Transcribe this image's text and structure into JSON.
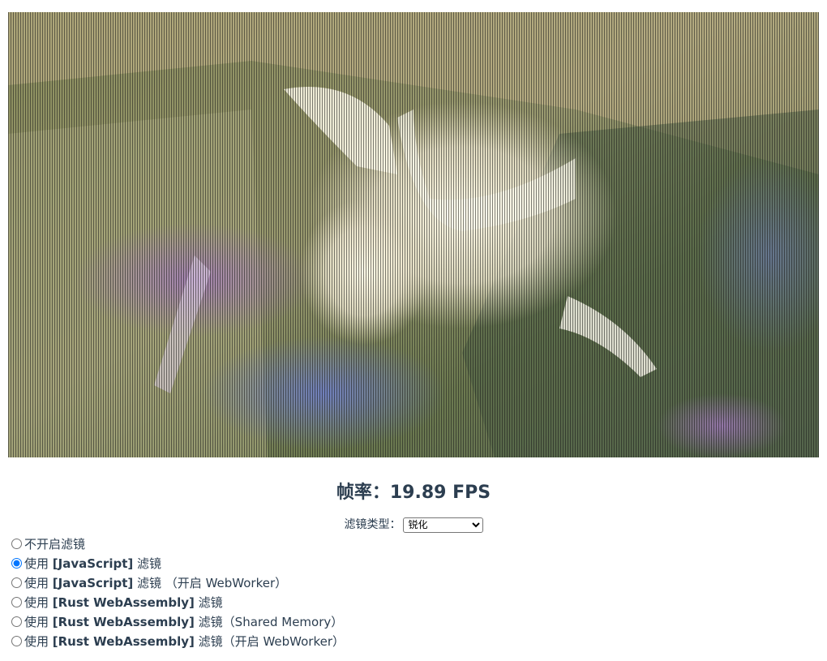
{
  "video": {
    "description_icon": "video-canvas"
  },
  "fps": {
    "label": "帧率：",
    "value": "19.89",
    "unit": "FPS"
  },
  "filter_type": {
    "label": "滤镜类型：",
    "selected": "锐化",
    "options": [
      "锐化"
    ]
  },
  "modes": [
    {
      "checked": false,
      "prefix": "不开启滤镜",
      "tech": "",
      "suffix": "",
      "extra": ""
    },
    {
      "checked": true,
      "prefix": "使用 ",
      "tech": "[JavaScript]",
      "suffix": " 滤镜",
      "extra": ""
    },
    {
      "checked": false,
      "prefix": "使用 ",
      "tech": "[JavaScript]",
      "suffix": " 滤镜",
      "extra": " （开启 WebWorker）"
    },
    {
      "checked": false,
      "prefix": "使用 ",
      "tech": "[Rust WebAssembly]",
      "suffix": " 滤镜",
      "extra": ""
    },
    {
      "checked": false,
      "prefix": "使用 ",
      "tech": "[Rust WebAssembly]",
      "suffix": " 滤镜",
      "extra": "（Shared Memory）"
    },
    {
      "checked": false,
      "prefix": "使用 ",
      "tech": "[Rust WebAssembly]",
      "suffix": " 滤镜",
      "extra": "（开启 WebWorker）"
    }
  ]
}
